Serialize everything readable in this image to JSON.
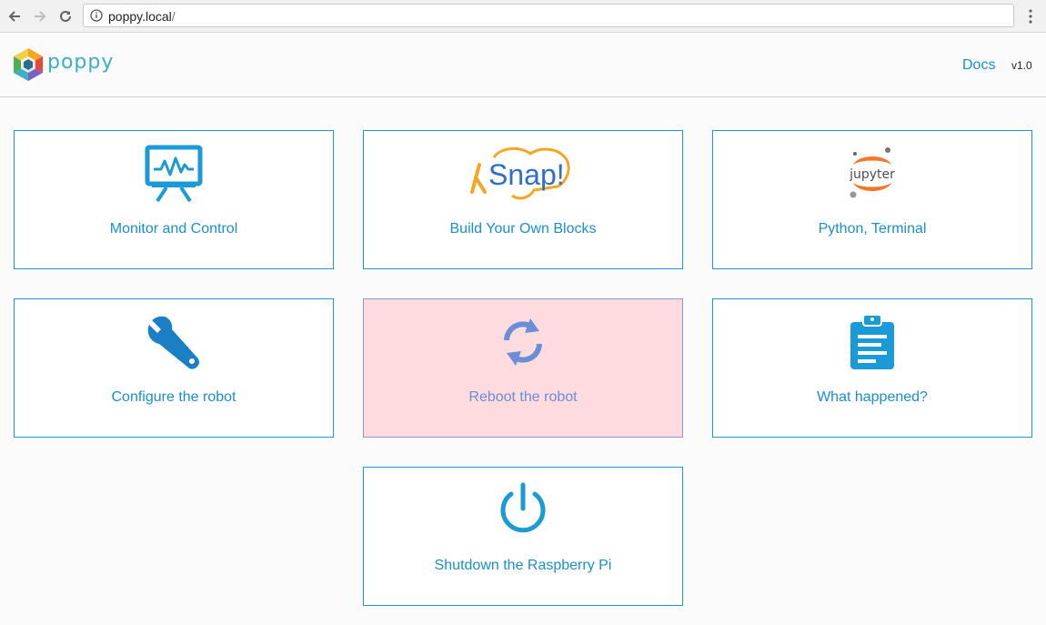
{
  "browser": {
    "url_host": "poppy.local",
    "url_path": "/"
  },
  "header": {
    "brand": "poppy",
    "docs_label": "Docs",
    "version": "v1.0"
  },
  "cards": [
    {
      "label": "Monitor and Control",
      "icon": "monitor-chart-icon"
    },
    {
      "label": "Build Your Own Blocks",
      "icon": "snap-logo-icon",
      "logo_text": "Snap!"
    },
    {
      "label": "Python, Terminal",
      "icon": "jupyter-logo-icon",
      "logo_text": "jupyter"
    },
    {
      "label": "Configure the robot",
      "icon": "wrench-icon"
    },
    {
      "label": "Reboot the robot",
      "icon": "refresh-icon"
    },
    {
      "label": "What happened?",
      "icon": "clipboard-icon"
    },
    {
      "label": "Shutdown the Raspberry Pi",
      "icon": "power-icon"
    }
  ],
  "colors": {
    "accent": "#1a8fd0",
    "card_border": "#1a9ad6",
    "active_card_bg": "#fedbde",
    "snap_orange": "#f5a623",
    "snap_blue": "#2f6fc8",
    "jupyter_orange": "#f37726"
  }
}
